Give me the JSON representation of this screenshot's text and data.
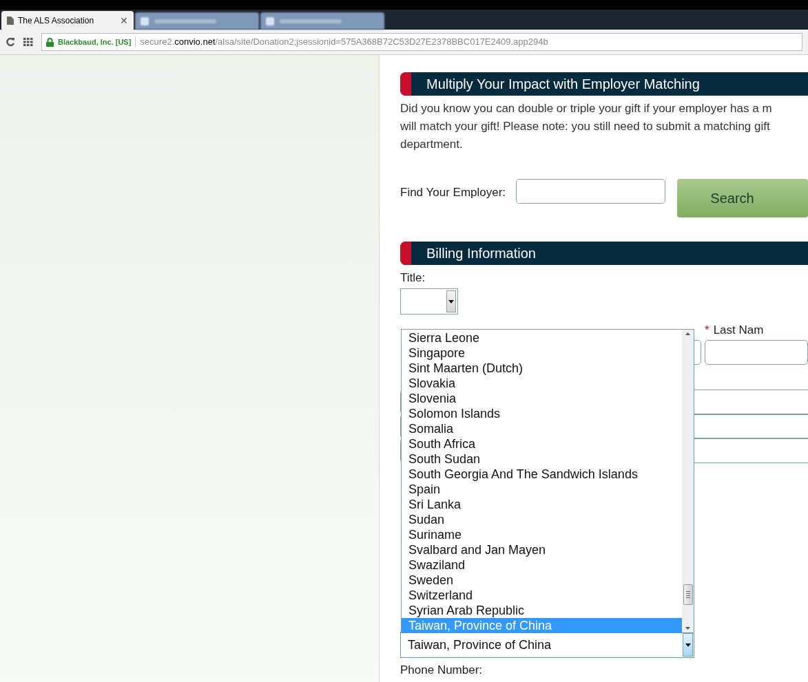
{
  "browser": {
    "tabs": [
      {
        "label": "The ALS Association",
        "close": "✕",
        "selected": true
      },
      {
        "selected": false
      },
      {
        "selected": false
      }
    ],
    "address_bar": {
      "site_identity": "Blackbaud, Inc. [US]",
      "url_prefix": "secure2.",
      "url_domain": "convio.net",
      "url_path": "/alsa/site/Donation2;jsessionid=575A368B72C53D27E2378BBC017E2409.app294b"
    }
  },
  "employer_matching": {
    "heading": "Multiply Your Impact with Employer Matching",
    "lines": [
      "Did you know you can double or triple your gift if your employer has a m",
      "will match your gift! Please note: you still need to submit a matching gift",
      "department."
    ],
    "find_label": "Find Your Employer:",
    "search_button": "Search"
  },
  "billing": {
    "heading": "Billing Information",
    "title_label": "Title:",
    "required_mark": "*",
    "last_name_label": "Last Nam",
    "country_value": "Taiwan, Province of China",
    "country_options": [
      {
        "label": "Sierra Leone",
        "selected": false
      },
      {
        "label": "Singapore",
        "selected": false
      },
      {
        "label": "Sint Maarten (Dutch)",
        "selected": false
      },
      {
        "label": "Slovakia",
        "selected": false
      },
      {
        "label": "Slovenia",
        "selected": false
      },
      {
        "label": "Solomon Islands",
        "selected": false
      },
      {
        "label": "Somalia",
        "selected": false
      },
      {
        "label": "South Africa",
        "selected": false
      },
      {
        "label": "South Sudan",
        "selected": false
      },
      {
        "label": "South Georgia And The Sandwich Islands",
        "selected": false
      },
      {
        "label": "Spain",
        "selected": false
      },
      {
        "label": "Sri Lanka",
        "selected": false
      },
      {
        "label": "Sudan",
        "selected": false
      },
      {
        "label": "Suriname",
        "selected": false
      },
      {
        "label": "Svalbard and Jan Mayen",
        "selected": false
      },
      {
        "label": "Swaziland",
        "selected": false
      },
      {
        "label": "Sweden",
        "selected": false
      },
      {
        "label": "Switzerland",
        "selected": false
      },
      {
        "label": "Syrian Arab Republic",
        "selected": false
      },
      {
        "label": "Taiwan, Province of China",
        "selected": true
      }
    ],
    "phone_label": "Phone Number:"
  }
}
